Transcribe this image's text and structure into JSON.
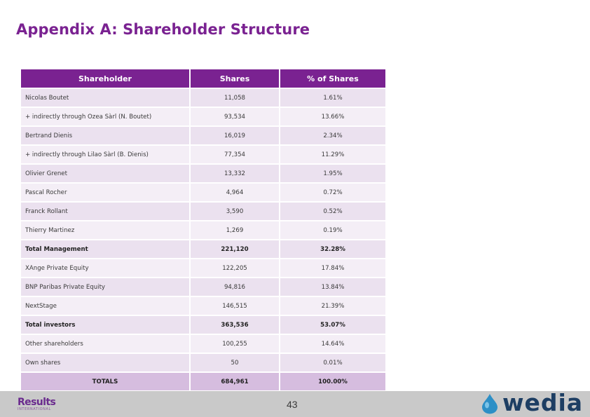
{
  "title": "Appendix A:  Shareholder Structure",
  "table": {
    "headers": [
      "Shareholder",
      "Shares",
      "% of Shares"
    ],
    "rows": [
      {
        "name": "Nicolas Boutet",
        "shares": "11,058",
        "pct": "1.61%"
      },
      {
        "name": "+ indirectly through Ozea Sàrl (N. Boutet)",
        "shares": "93,534",
        "pct": "13.66%"
      },
      {
        "name": "Bertrand Dienis",
        "shares": "16,019",
        "pct": "2.34%"
      },
      {
        "name": "+ indirectly through Lilao Sàrl (B. Dienis)",
        "shares": "77,354",
        "pct": "11.29%"
      },
      {
        "name": "Olivier Grenet",
        "shares": "13,332",
        "pct": "1.95%"
      },
      {
        "name": "Pascal Rocher",
        "shares": "4,964",
        "pct": "0.72%"
      },
      {
        "name": "Franck Rollant",
        "shares": "3,590",
        "pct": "0.52%"
      },
      {
        "name": "Thierry Martinez",
        "shares": "1,269",
        "pct": "0.19%"
      },
      {
        "name": "Total Management",
        "shares": "221,120",
        "pct": "32.28%"
      },
      {
        "name": "XAnge Private Equity",
        "shares": "122,205",
        "pct": "17.84%"
      },
      {
        "name": "BNP Paribas Private Equity",
        "shares": "94,816",
        "pct": "13.84%"
      },
      {
        "name": "NextStage",
        "shares": "146,515",
        "pct": "21.39%"
      },
      {
        "name": "Total investors",
        "shares": "363,536",
        "pct": "53.07%"
      },
      {
        "name": "Other shareholders",
        "shares": "100,255",
        "pct": "14.64%"
      },
      {
        "name": "Own shares",
        "shares": "50",
        "pct": "0.01%"
      }
    ],
    "total": {
      "name": "TOTALS",
      "shares": "684,961",
      "pct": "100.00%"
    }
  },
  "footer": {
    "page_number": "43",
    "results_logo": {
      "line1": "Results",
      "line2": "INTERNATIONAL"
    },
    "wedia_logo": "wedia"
  },
  "colors": {
    "brand_purple": "#7a2291",
    "row_light": "#ebe1ef",
    "totals_row": "#d6bddf",
    "footer_gray": "#c9c9c9",
    "wedia_navy": "#1d3e63",
    "wedia_drop": "#2d8fc6"
  }
}
